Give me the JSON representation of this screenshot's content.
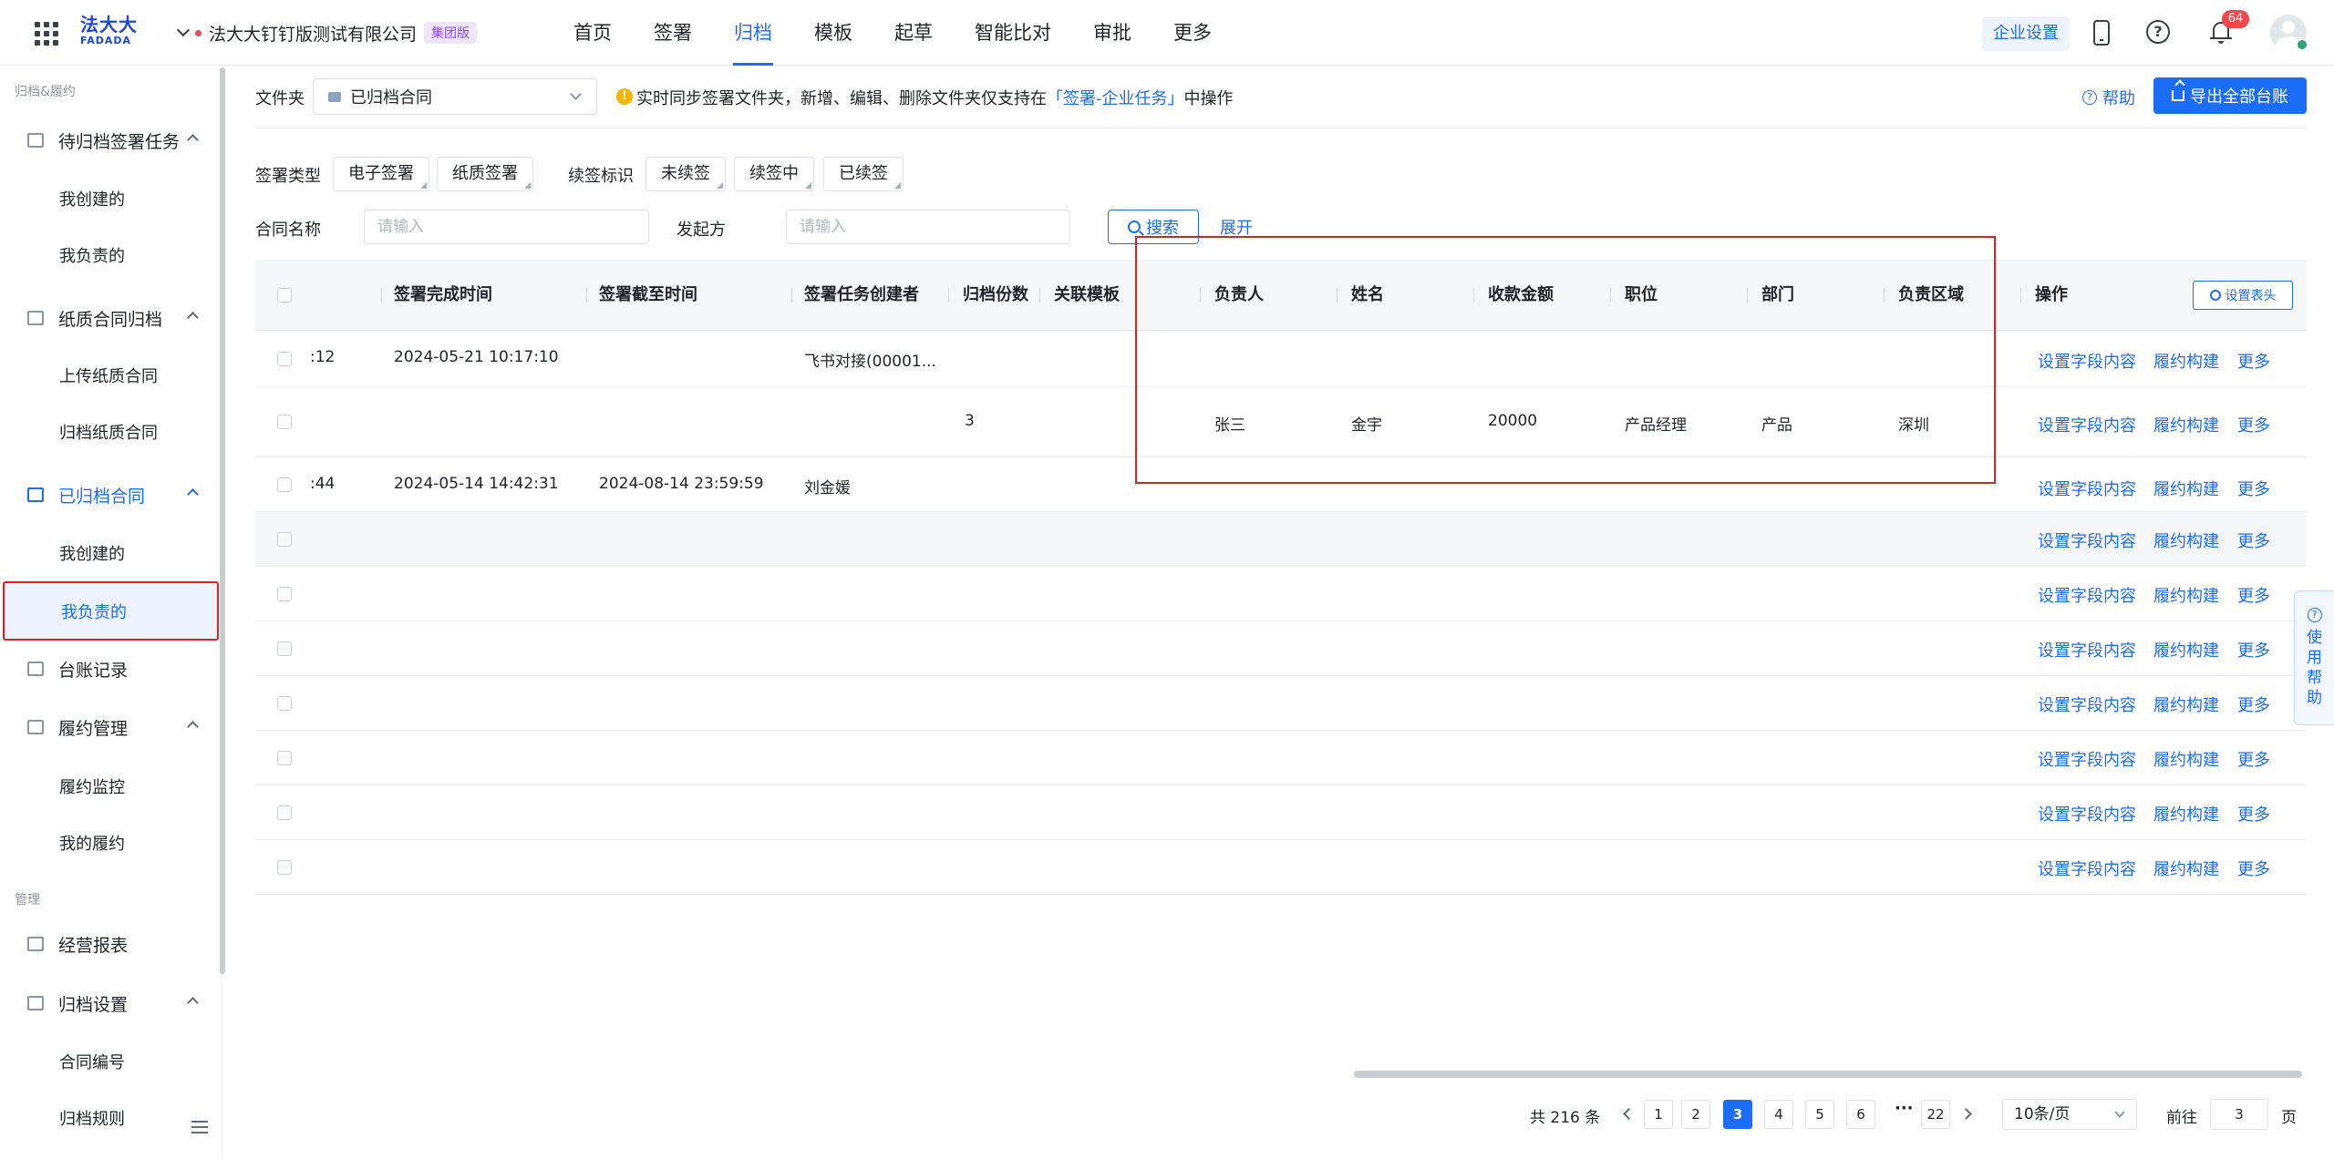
{
  "header": {
    "logo_cn": "法大大",
    "logo_en": "FADADA",
    "company": "法大大钉钉版测试有限公司",
    "company_badge": "集团版",
    "nav": [
      "首页",
      "签署",
      "归档",
      "模板",
      "起草",
      "智能比对",
      "审批",
      "更多"
    ],
    "active_nav": "归档",
    "enterprise_settings": "企业设置",
    "notification_count": "64"
  },
  "sidebar": {
    "section1": "归档&履约",
    "section2": "管理",
    "groups": {
      "pending": "待归档签署任务",
      "paper": "纸质合同归档",
      "archived": "已归档合同",
      "ledger": "台账记录",
      "performance": "履约管理",
      "report": "经营报表",
      "settings": "归档设置"
    },
    "items": {
      "pending_created": "我创建的",
      "pending_owned": "我负责的",
      "paper_upload": "上传纸质合同",
      "paper_archive": "归档纸质合同",
      "archived_created": "我创建的",
      "archived_owned": "我负责的",
      "perf_monitor": "履约监控",
      "perf_mine": "我的履约",
      "settings_number": "合同编号",
      "settings_rules": "归档规则"
    }
  },
  "filters": {
    "folder_label": "文件夹",
    "folder_value": "已归档合同",
    "notice_prefix": "实时同步签署文件夹，新增、编辑、删除文件夹仅支持在",
    "notice_link": "「签署-企业任务」",
    "notice_suffix": "中操作",
    "help": "帮助",
    "export": "导出全部台账",
    "sign_type_label": "签署类型",
    "sign_types": [
      "电子签署",
      "纸质签署"
    ],
    "renew_label": "续签标识",
    "renew_tags": [
      "未续签",
      "续签中",
      "已续签"
    ],
    "contract_name_label": "合同名称",
    "contract_name_placeholder": "请输入",
    "initiator_label": "发起方",
    "initiator_placeholder": "请输入",
    "search": "搜索",
    "expand": "展开"
  },
  "table": {
    "columns": {
      "completed": "签署完成时间",
      "deadline": "签署截至时间",
      "creator": "签署任务创建者",
      "copies": "归档份数",
      "template": "关联模板",
      "owner": "负责人",
      "name": "姓名",
      "amount": "收款金额",
      "position": "职位",
      "dept": "部门",
      "region": "负责区域",
      "ops": "操作"
    },
    "set_columns": "设置表头",
    "rows": [
      {
        "time_frag": ":12",
        "completed": "2024-05-21 10:17:10",
        "deadline": "",
        "creator": "飞书对接(00001...",
        "copies": "",
        "owner": "",
        "name": "",
        "amount": "",
        "position": "",
        "dept": "",
        "region": ""
      },
      {
        "time_frag": "",
        "completed": "",
        "deadline": "",
        "creator": "",
        "copies": "3",
        "owner": "张三",
        "name": "金宇",
        "amount": "20000",
        "position": "产品经理",
        "dept": "产品",
        "region": "深圳"
      },
      {
        "time_frag": ":44",
        "completed": "2024-05-14 14:42:31",
        "deadline": "2024-08-14 23:59:59",
        "creator": "刘金媛",
        "copies": "",
        "owner": "",
        "name": "",
        "amount": "",
        "position": "",
        "dept": "",
        "region": ""
      }
    ],
    "ops": {
      "set_fields": "设置字段内容",
      "build": "履约构建",
      "more": "更多"
    }
  },
  "pagination": {
    "total": "共 216 条",
    "pages": [
      "1",
      "2",
      "3",
      "4",
      "5",
      "6"
    ],
    "current": "3",
    "last": "22",
    "page_size": "10条/页",
    "goto_label": "前往",
    "goto_value": "3",
    "page_suffix": "页"
  },
  "float_help": "使用帮助",
  "colors": {
    "primary": "#1c6df5",
    "highlight": "#e81e1e",
    "badge": "#f5474b"
  }
}
